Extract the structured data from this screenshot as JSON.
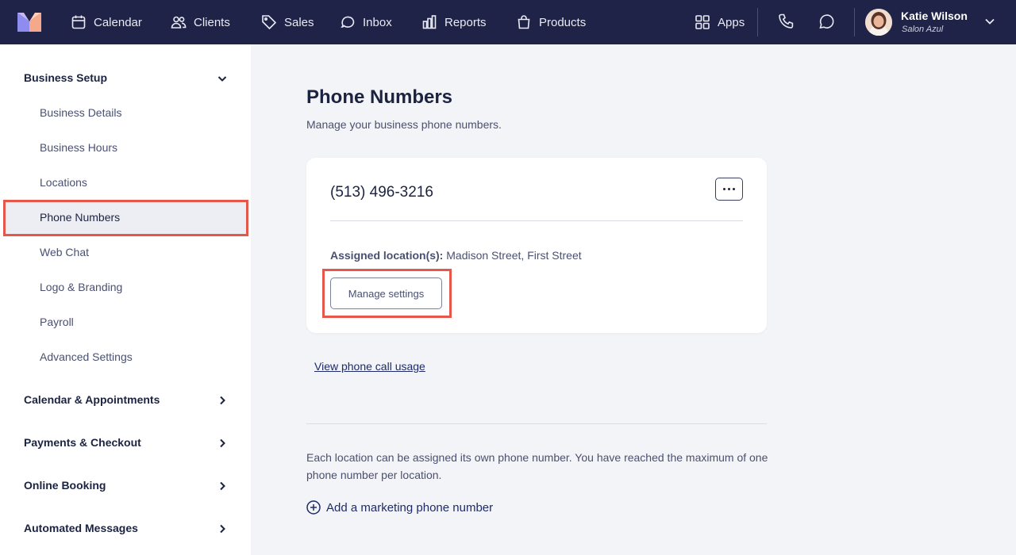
{
  "topbar": {
    "nav": [
      {
        "label": "Calendar",
        "icon": "calendar-icon"
      },
      {
        "label": "Clients",
        "icon": "users-icon"
      },
      {
        "label": "Sales",
        "icon": "tag-icon"
      },
      {
        "label": "Inbox",
        "icon": "inbox-icon"
      },
      {
        "label": "Reports",
        "icon": "bar-chart-icon"
      },
      {
        "label": "Products",
        "icon": "shopping-bag-icon"
      }
    ],
    "apps_label": "Apps",
    "user": {
      "name": "Katie Wilson",
      "org": "Salon Azul"
    }
  },
  "sidebar": {
    "sections": [
      {
        "label": "Business Setup",
        "expanded": true
      },
      {
        "label": "Calendar & Appointments",
        "expanded": false
      },
      {
        "label": "Payments & Checkout",
        "expanded": false
      },
      {
        "label": "Online Booking",
        "expanded": false
      },
      {
        "label": "Automated Messages",
        "expanded": false
      }
    ],
    "items": [
      {
        "label": "Business Details"
      },
      {
        "label": "Business Hours"
      },
      {
        "label": "Locations"
      },
      {
        "label": "Phone Numbers",
        "active": true
      },
      {
        "label": "Web Chat"
      },
      {
        "label": "Logo & Branding"
      },
      {
        "label": "Payroll"
      },
      {
        "label": "Advanced Settings"
      }
    ]
  },
  "main": {
    "title": "Phone Numbers",
    "subtitle": "Manage your business phone numbers.",
    "card": {
      "phone": "(513) 496-3216",
      "assigned_label": "Assigned location(s):",
      "assigned_value": "Madison Street, First Street",
      "manage_button": "Manage settings"
    },
    "usage_link": "View phone call usage",
    "info_text": "Each location can be assigned its own phone number. You have reached the maximum of one phone number per location.",
    "add_link": "Add a marketing phone number"
  },
  "colors": {
    "topbar_bg": "#1f2347",
    "highlight_border": "#e5574a",
    "link": "#1f2a6b"
  }
}
